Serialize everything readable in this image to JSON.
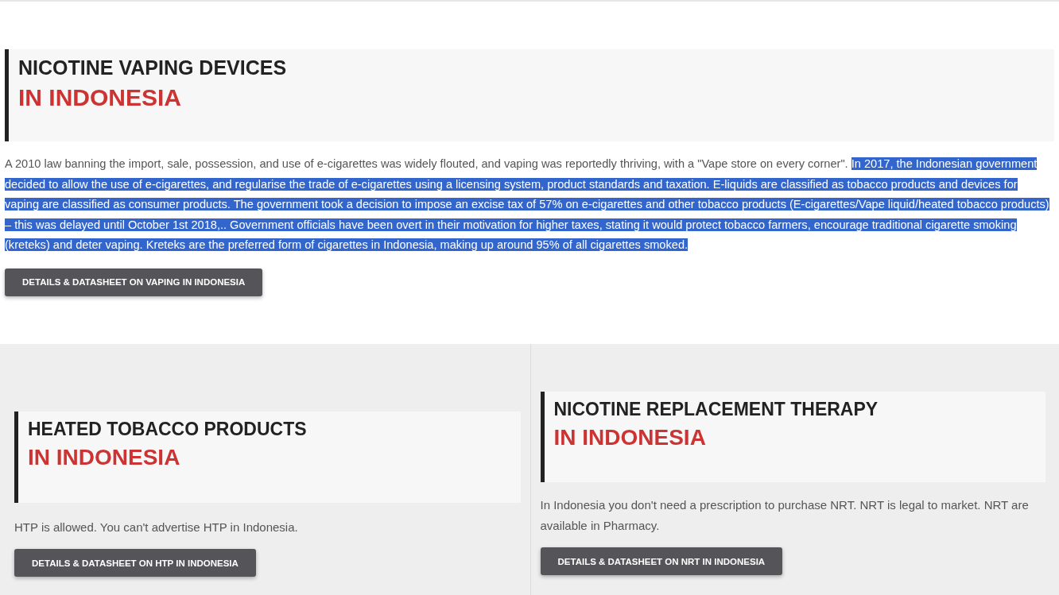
{
  "vaping": {
    "title": "NICOTINE VAPING DEVICES",
    "subtitle": "IN INDONESIA",
    "paragraph": [
      {
        "text": "A 2010 law banning the import, sale, possession, and use of e-cigarettes was widely flouted, and vaping was reportedly thriving, with a \"Vape store on every corner\".",
        "selected": false
      },
      {
        "text": "In 2017, the Indonesian government decided to allow the use of e-cigarettes, and regularise the trade of e-cigarettes using a licensing system, product standards and taxation. E-liquids are classified as tobacco products and devices for vaping are classified as consumer products. The government took a decision to impose an excise tax of 57% on e-cigarettes and other tobacco products (E-cigarettes/Vape liquid/heated tobacco products) – this was delayed until October 1st 2018,.. Government officials have been overt in their motivation for higher taxes, stating it would protect tobacco farmers, encourage traditional cigarette smoking (kreteks) and deter vaping. Kreteks are the preferred form of cigarettes in Indonesia, making up around 95% of all cigarettes smoked.",
        "selected": true
      }
    ],
    "button": "DETAILS & DATASHEET ON VAPING IN INDONESIA"
  },
  "columns": [
    {
      "title": "HEATED TOBACCO PRODUCTS",
      "subtitle": "IN INDONESIA",
      "text": "HTP is allowed. You can't advertise HTP in Indonesia.",
      "button": "DETAILS & DATASHEET ON HTP IN INDONESIA"
    },
    {
      "title": "NICOTINE REPLACEMENT THERAPY",
      "subtitle": "IN INDONESIA",
      "text": "In Indonesia you don't need a prescription to purchase NRT. NRT is legal to market. NRT are available in Pharmacy.",
      "button": "DETAILS & DATASHEET ON NRT IN INDONESIA"
    }
  ]
}
